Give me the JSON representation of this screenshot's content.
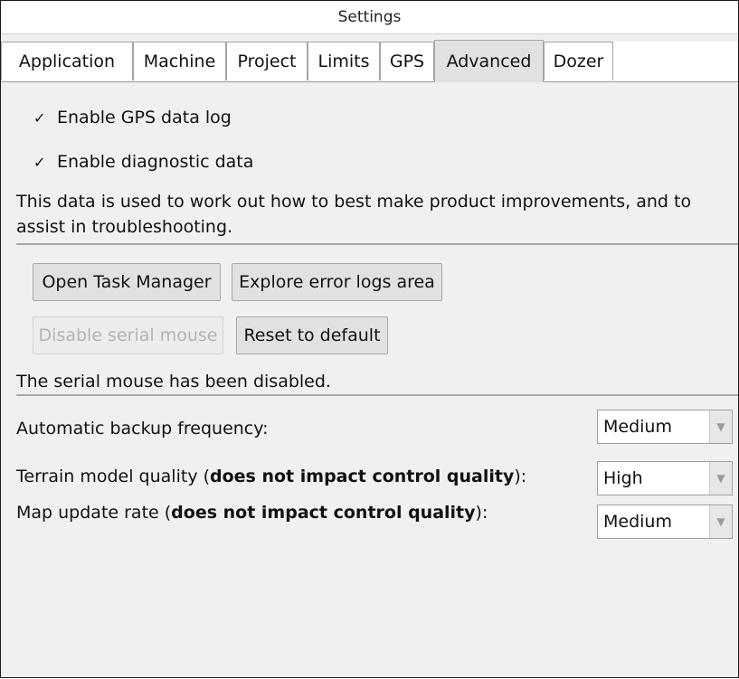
{
  "window": {
    "title": "Settings"
  },
  "tabs": [
    {
      "label": "Application"
    },
    {
      "label": "Machine"
    },
    {
      "label": "Project"
    },
    {
      "label": "Limits"
    },
    {
      "label": "GPS"
    },
    {
      "label": "Advanced",
      "active": true
    },
    {
      "label": "Dozer"
    }
  ],
  "advanced": {
    "gps_log": {
      "label": "Enable GPS data log",
      "checked": true,
      "check_glyph": "✓"
    },
    "diagnostic": {
      "label": "Enable diagnostic data",
      "checked": true,
      "check_glyph": "✓"
    },
    "description": "This data is used to work out how to best make product improvements, and to assist in troubleshooting.",
    "buttons": {
      "task_manager": "Open Task Manager",
      "error_logs": "Explore error logs area",
      "disable_serial_mouse": "Disable serial mouse",
      "reset_default": "Reset to default"
    },
    "serial_mouse_status": "The serial mouse has been disabled.",
    "backup": {
      "label": "Automatic backup frequency:",
      "value": "Medium"
    },
    "terrain": {
      "label_prefix": "Terrain model quality (",
      "label_bold": "does not impact control quality",
      "label_suffix": "):",
      "value": "High"
    },
    "map_rate": {
      "label_prefix": "Map update rate (",
      "label_bold": "does not impact control quality",
      "label_suffix": "):",
      "value": "Medium"
    }
  },
  "colors": {
    "panel_bg": "#f0f0f0",
    "button_bg": "#e1e1e1",
    "disabled_text": "#b3b3b3"
  },
  "icons": {
    "checkbox": "checkmark-icon",
    "combo_arrow": "chevron-down-icon"
  }
}
